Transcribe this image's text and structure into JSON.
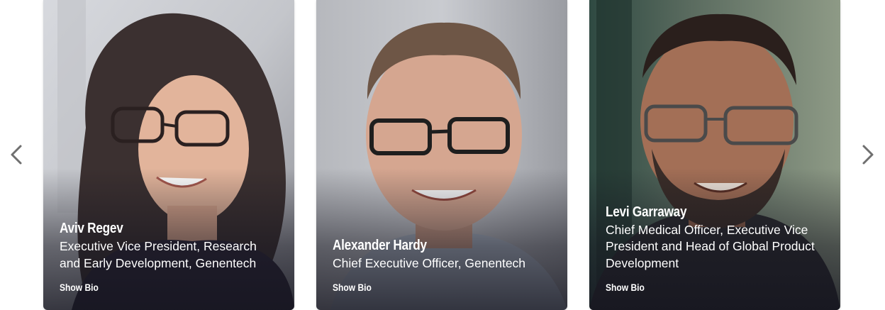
{
  "carousel": {
    "prev_icon": "chevron-left-icon",
    "next_icon": "chevron-right-icon",
    "arrow_color": "#6f6f6f"
  },
  "cards": [
    {
      "name": "Aviv Regev",
      "title_lines": [
        "Executive Vice President, Research",
        "and Early Development, Genentech"
      ],
      "bio_link": "Show Bio"
    },
    {
      "name": "Alexander Hardy",
      "title_lines": [
        "Chief Executive Officer, Genentech"
      ],
      "bio_link": "Show Bio"
    },
    {
      "name": "Levi Garraway",
      "title_lines": [
        "Chief Medical Officer, Executive Vice",
        "President and Head of Global Product",
        "Development"
      ],
      "bio_link": "Show Bio"
    }
  ]
}
